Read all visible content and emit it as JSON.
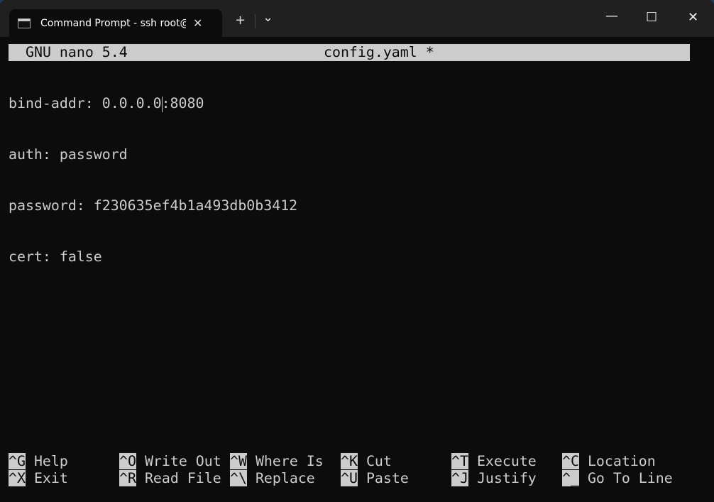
{
  "window": {
    "tab_title": "Command Prompt - ssh  root@",
    "new_tab": "+",
    "dropdown": "⌄",
    "close_tab": "✕",
    "minimize": "—",
    "maximize": "☐",
    "close": "✕"
  },
  "nano": {
    "version": "GNU nano 5.4",
    "filename": "config.yaml *",
    "lines": [
      {
        "before_cursor": "bind-addr: 0.0.0.0",
        "after_cursor": ":8080"
      },
      {
        "text": "auth: password"
      },
      {
        "text": "password: f230635ef4b1a493db0b3412"
      },
      {
        "text": "cert: false"
      }
    ],
    "shortcuts": [
      {
        "key": "^G",
        "label": "Help"
      },
      {
        "key": "^X",
        "label": "Exit"
      },
      {
        "key": "^O",
        "label": "Write Out"
      },
      {
        "key": "^R",
        "label": "Read File"
      },
      {
        "key": "^W",
        "label": "Where Is"
      },
      {
        "key": "^\\",
        "label": "Replace"
      },
      {
        "key": "^K",
        "label": "Cut"
      },
      {
        "key": "^U",
        "label": "Paste"
      },
      {
        "key": "^T",
        "label": "Execute"
      },
      {
        "key": "^J",
        "label": "Justify"
      },
      {
        "key": "^C",
        "label": "Location"
      },
      {
        "key": "^_",
        "label": "Go To Line"
      }
    ]
  }
}
